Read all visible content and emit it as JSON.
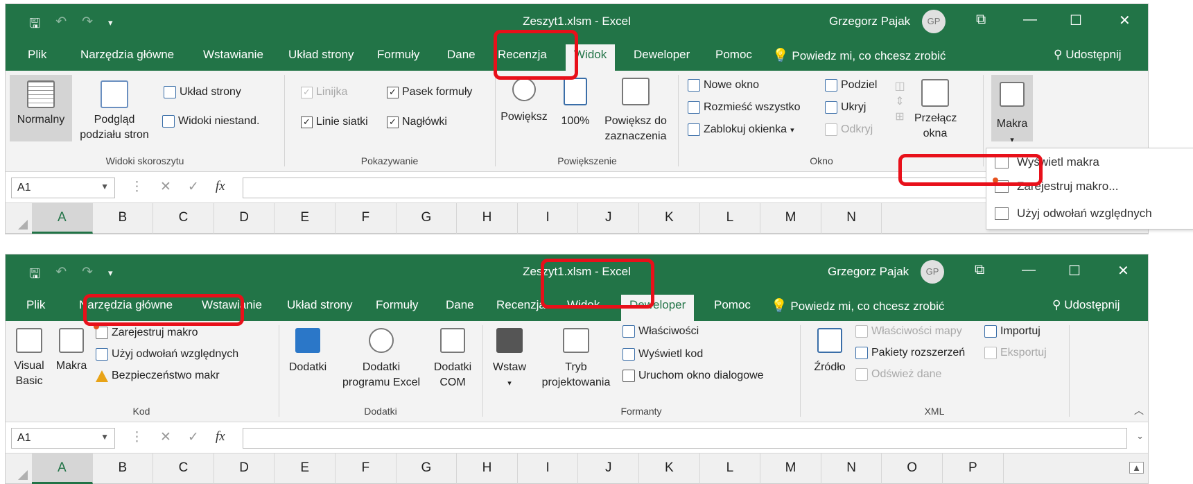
{
  "window1": {
    "title": "Zeszyt1.xlsm  -  Excel",
    "user": "Grzegorz Pajak",
    "avatar": "GP",
    "tabs": [
      "Plik",
      "Narzędzia główne",
      "Wstawianie",
      "Układ strony",
      "Formuły",
      "Dane",
      "Recenzja",
      "Widok",
      "Deweloper",
      "Pomoc"
    ],
    "active_tab": "Widok",
    "tell_me": "Powiedz mi, co chcesz zrobić",
    "share": "Udostępnij",
    "groups": {
      "widoki": {
        "label": "Widoki skoroszytu",
        "normal": "Normalny",
        "page_break": "Podgląd podziału stron",
        "page_layout": "Układ strony",
        "custom_views": "Widoki niestand."
      },
      "show": {
        "label": "Pokazywanie",
        "ruler": "Linijka",
        "formula_bar": "Pasek formuły",
        "gridlines": "Linie siatki",
        "headings": "Nagłówki"
      },
      "zoom": {
        "label": "Powiększenie",
        "zoom": "Powiększ",
        "zoom100": "100%",
        "zoom_selection": "Powiększ do zaznaczenia"
      },
      "window": {
        "label": "Okno",
        "new_window": "Nowe okno",
        "arrange_all": "Rozmieść wszystko",
        "freeze_panes": "Zablokuj okienka",
        "split": "Podziel",
        "hide": "Ukryj",
        "unhide": "Odkryj",
        "switch_windows": "Przełącz okna"
      },
      "macros": {
        "label": "Makra"
      }
    },
    "menu": {
      "view_macros": "Wyświetl makra",
      "record_macro": "Zarejestruj makro...",
      "relative_refs": "Użyj odwołań względnych"
    },
    "name_box": "A1",
    "columns": [
      "A",
      "B",
      "C",
      "D",
      "E",
      "F",
      "G",
      "H",
      "I",
      "J",
      "K",
      "L",
      "M",
      "N"
    ]
  },
  "window2": {
    "title": "Zeszyt1.xlsm  -  Excel",
    "user": "Grzegorz Pajak",
    "avatar": "GP",
    "tabs": [
      "Plik",
      "Narzędzia główne",
      "Wstawianie",
      "Układ strony",
      "Formuły",
      "Dane",
      "Recenzja",
      "Widok",
      "Deweloper",
      "Pomoc"
    ],
    "active_tab": "Deweloper",
    "tell_me": "Powiedz mi, co chcesz zrobić",
    "share": "Udostępnij",
    "groups": {
      "code": {
        "label": "Kod",
        "visual_basic": "Visual Basic",
        "macros": "Makra",
        "record_macro": "Zarejestruj makro",
        "relative_refs": "Użyj odwołań względnych",
        "macro_security": "Bezpieczeństwo makr"
      },
      "addins": {
        "label": "Dodatki",
        "addins": "Dodatki",
        "excel_addins": "Dodatki programu Excel",
        "com_addins": "Dodatki COM"
      },
      "controls": {
        "label": "Formanty",
        "insert": "Wstaw",
        "design_mode": "Tryb projektowania",
        "properties": "Właściwości",
        "view_code": "Wyświetl kod",
        "run_dialog": "Uruchom okno dialogowe"
      },
      "xml": {
        "label": "XML",
        "source": "Źródło",
        "map_properties": "Właściwości mapy",
        "expansion_packs": "Pakiety rozszerzeń",
        "refresh_data": "Odśwież dane",
        "import": "Importuj",
        "export": "Eksportuj"
      }
    },
    "name_box": "A1",
    "columns": [
      "A",
      "B",
      "C",
      "D",
      "E",
      "F",
      "G",
      "H",
      "I",
      "J",
      "K",
      "L",
      "M",
      "N",
      "O",
      "P"
    ]
  },
  "colors": {
    "excel_green": "#227447",
    "highlight_red": "#e8101a",
    "ribbon_bg": "#f3f3f3"
  }
}
